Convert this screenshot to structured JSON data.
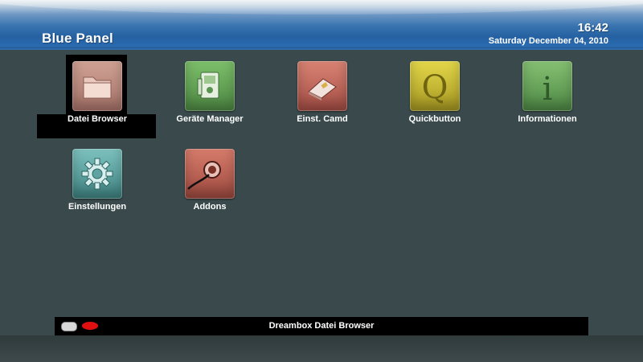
{
  "header": {
    "title": "Blue Panel",
    "time": "16:42",
    "date": "Saturday December 04, 2010"
  },
  "menu": {
    "selected_index": 0,
    "items": [
      {
        "label": "Datei Browser",
        "icon": "folder-icon",
        "color": "#b88074"
      },
      {
        "label": "Geräte Manager",
        "icon": "device-manager-icon",
        "color": "#5fa052"
      },
      {
        "label": "Einst. Camd",
        "icon": "camd-card-icon",
        "color": "#c0645a"
      },
      {
        "label": "Quickbutton",
        "icon": "quickbutton-q-icon",
        "color": "#cbc032"
      },
      {
        "label": "Informationen",
        "icon": "info-icon",
        "color": "#6ba860"
      },
      {
        "label": "Einstellungen",
        "icon": "settings-gear-icon",
        "color": "#5fa4a2"
      },
      {
        "label": "Addons",
        "icon": "addons-plug-icon",
        "color": "#c0604f"
      }
    ]
  },
  "footer": {
    "description": "Dreambox Datei Browser",
    "remote_icon": "remote-control-icon",
    "key_icon": "red-button-icon",
    "key_color": "#e01010"
  }
}
